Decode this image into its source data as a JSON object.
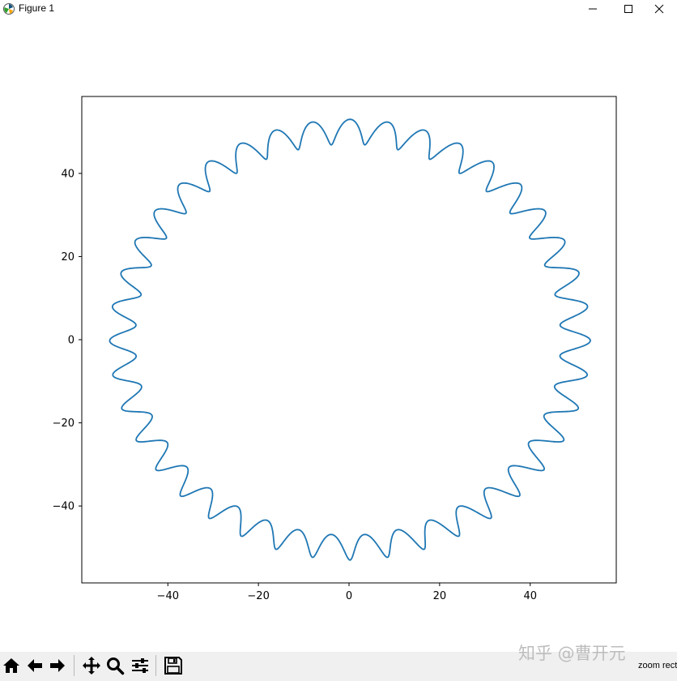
{
  "window": {
    "title": "Figure 1",
    "icon": "matplotlib-icon",
    "controls": [
      "minimize-icon",
      "maximize-icon",
      "close-icon"
    ]
  },
  "chart_data": {
    "type": "line",
    "title": "",
    "xlabel": "",
    "ylabel": "",
    "xlim": [
      -59,
      59
    ],
    "ylim": [
      -58.5,
      58.5
    ],
    "xticks": [
      -40,
      -20,
      0,
      20,
      40
    ],
    "yticks": [
      -40,
      -20,
      0,
      20,
      40
    ],
    "xtick_labels": [
      "−40",
      "−20",
      "0",
      "20",
      "40"
    ],
    "ytick_labels": [
      "−40",
      "−20",
      "0",
      "20",
      "40"
    ],
    "grid": false,
    "series": [
      {
        "color": "#1f77b4",
        "parametric": {
          "x": "(50 + 3*cos(40*t)) * cos(t) + 0.6*cos(40*t+1.2)",
          "y": "(50 + 3*cos(40*t)) * sin(t)",
          "t_range": [
            0,
            6.2832
          ],
          "base_radius": 50,
          "ripple_amplitude": 3,
          "ripple_count": 40
        }
      }
    ]
  },
  "toolbar": {
    "buttons": [
      "home-icon",
      "back-icon",
      "forward-icon",
      "pan-icon",
      "zoom-icon",
      "configure-subplots-icon",
      "save-icon"
    ],
    "status_text": "zoom rect"
  },
  "watermark": "知乎 @曹开元"
}
